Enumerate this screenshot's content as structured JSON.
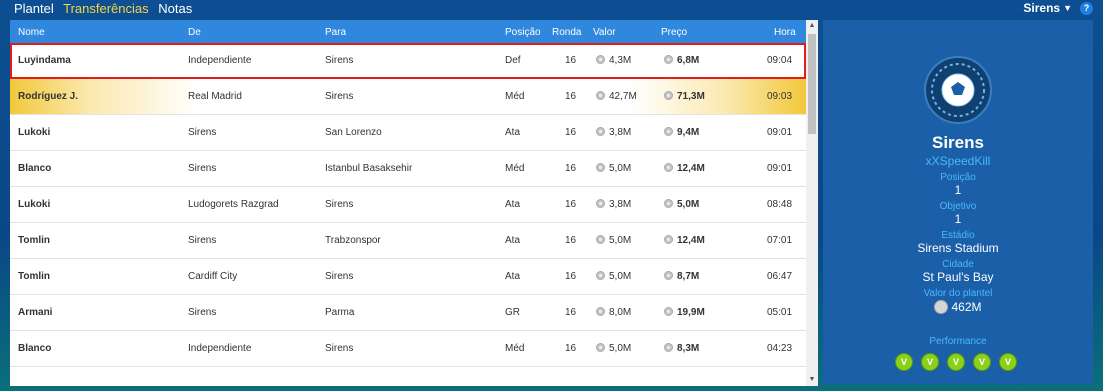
{
  "nav": {
    "tabs": [
      {
        "label": "Plantel"
      },
      {
        "label": "Transferências"
      },
      {
        "label": "Notas"
      }
    ],
    "team_menu": "Sirens",
    "help": "?"
  },
  "table": {
    "headers": {
      "nome": "Nome",
      "de": "De",
      "para": "Para",
      "posicao": "Posição",
      "ronda": "Ronda",
      "valor": "Valor",
      "preco": "Preço",
      "hora": "Hora"
    },
    "rows": [
      {
        "nome": "Luyindama",
        "de": "Independiente",
        "para": "Sirens",
        "posicao": "Def",
        "ronda": "16",
        "valor": "4,3M",
        "preco": "6,8M",
        "hora": "09:04"
      },
      {
        "nome": "Rodríguez J.",
        "de": "Real Madrid",
        "para": "Sirens",
        "posicao": "Méd",
        "ronda": "16",
        "valor": "42,7M",
        "preco": "71,3M",
        "hora": "09:03"
      },
      {
        "nome": "Lukoki",
        "de": "Sirens",
        "para": "San Lorenzo",
        "posicao": "Ata",
        "ronda": "16",
        "valor": "3,8M",
        "preco": "9,4M",
        "hora": "09:01"
      },
      {
        "nome": "Blanco",
        "de": "Sirens",
        "para": "Istanbul Basaksehir",
        "posicao": "Méd",
        "ronda": "16",
        "valor": "5,0M",
        "preco": "12,4M",
        "hora": "09:01"
      },
      {
        "nome": "Lukoki",
        "de": "Ludogorets Razgrad",
        "para": "Sirens",
        "posicao": "Ata",
        "ronda": "16",
        "valor": "3,8M",
        "preco": "5,0M",
        "hora": "08:48"
      },
      {
        "nome": "Tomlin",
        "de": "Sirens",
        "para": "Trabzonspor",
        "posicao": "Ata",
        "ronda": "16",
        "valor": "5,0M",
        "preco": "12,4M",
        "hora": "07:01"
      },
      {
        "nome": "Tomlin",
        "de": "Cardiff City",
        "para": "Sirens",
        "posicao": "Ata",
        "ronda": "16",
        "valor": "5,0M",
        "preco": "8,7M",
        "hora": "06:47"
      },
      {
        "nome": "Armani",
        "de": "Sirens",
        "para": "Parma",
        "posicao": "GR",
        "ronda": "16",
        "valor": "8,0M",
        "preco": "19,9M",
        "hora": "05:01"
      },
      {
        "nome": "Blanco",
        "de": "Independiente",
        "para": "Sirens",
        "posicao": "Méd",
        "ronda": "16",
        "valor": "5,0M",
        "preco": "8,3M",
        "hora": "04:23"
      }
    ]
  },
  "panel": {
    "club_name": "Sirens",
    "manager": "xXSpeedKill",
    "posicao_label": "Posição",
    "posicao_value": "1",
    "objetivo_label": "Objetivo",
    "objetivo_value": "1",
    "estadio_label": "Estádio",
    "estadio_value": "Sirens Stadium",
    "cidade_label": "Cidade",
    "cidade_value": "St Paul's Bay",
    "valor_label": "Valor do plantel",
    "valor_value": "462M",
    "performance_label": "Performance",
    "performance": [
      "V",
      "V",
      "V",
      "V",
      "V"
    ]
  },
  "colors": {
    "accent": "#2f87de",
    "active_tab": "#f3d44a",
    "selected_border": "#e21b1b",
    "win_badge": "#8bd11a"
  }
}
